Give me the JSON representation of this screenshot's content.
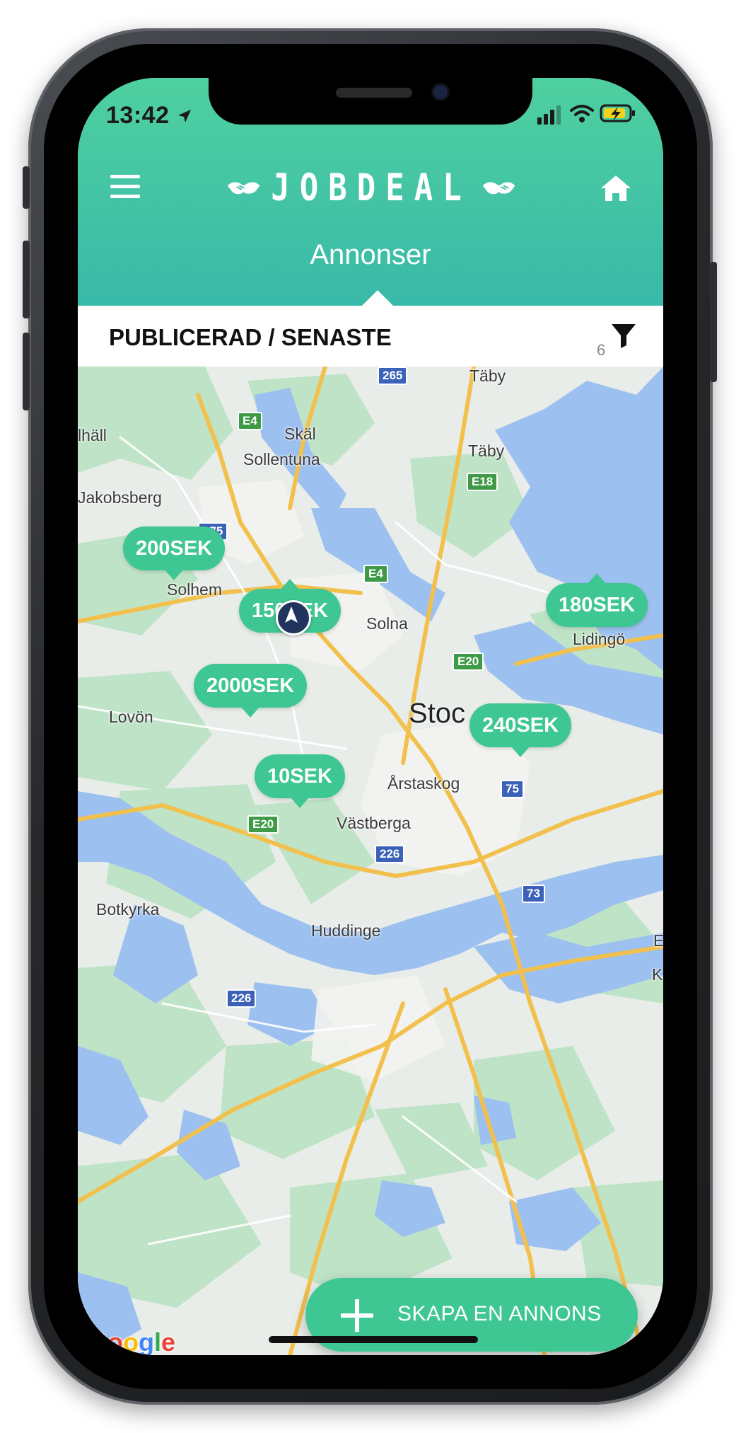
{
  "status_bar": {
    "time": "13:42"
  },
  "header": {
    "brand": "JOBDEAL",
    "section_title": "Annonser"
  },
  "filter_bar": {
    "label": "PUBLICERAD / SENASTE",
    "count": "6"
  },
  "map": {
    "places": {
      "taby_top": "Täby",
      "taby": "Täby",
      "skal": "Skäl",
      "sollentuna": "Sollentuna",
      "jakobsberg": "Jakobsberg",
      "hall": "lhäll",
      "solhem": "Solhem",
      "solna": "Solna",
      "lidingo": "Lidingö",
      "lovon": "Lovön",
      "stockholm": "Stoc",
      "arstaskog": "Årstaskog",
      "vastberga": "Västberga",
      "botkyrka": "Botkyrka",
      "huddinge": "Huddinge",
      "edge_b": "E",
      "edge_k": "K"
    },
    "shields": {
      "r265": "265",
      "e4a": "E4",
      "e18": "E18",
      "r275": "275",
      "e4b": "E4",
      "e20a": "E20",
      "r75": "75",
      "e20b": "E20",
      "r226a": "226",
      "r73": "73",
      "r226b": "226"
    },
    "markers": {
      "m200": "200SEK",
      "m150": "150SEK",
      "m180": "180SEK",
      "m2000": "2000SEK",
      "m240": "240SEK",
      "m10": "10SEK"
    },
    "attribution": "Google"
  },
  "fab": {
    "label": "SKAPA EN ANNONS"
  },
  "colors": {
    "accent": "#3ec793",
    "header_top": "#4fd0a0",
    "header_bottom": "#39b9a8",
    "water": "#9cc0f0",
    "park": "#b9e0c2",
    "road": "#f4c350"
  },
  "icons": [
    "menu-icon",
    "handshake-icon",
    "home-icon",
    "filter-icon",
    "plus-icon",
    "location-arrow-icon",
    "wifi-icon",
    "battery-charging-icon",
    "signal-icon"
  ]
}
